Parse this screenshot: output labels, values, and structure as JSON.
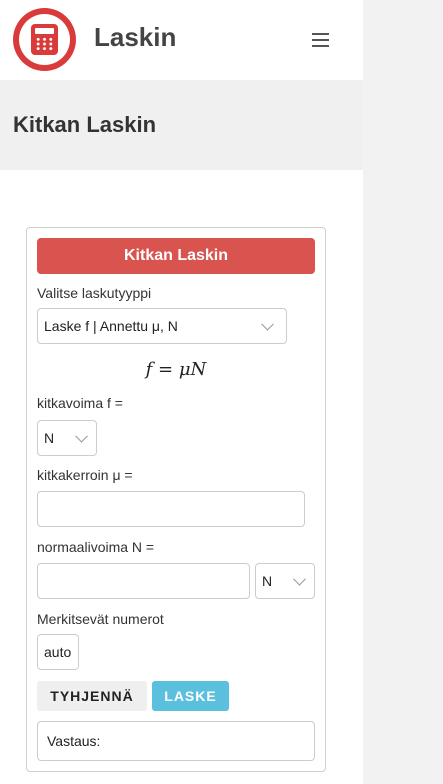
{
  "app": {
    "title": "Laskin",
    "logo_icon": "calculator-icon",
    "brand_color": "#d93b3b"
  },
  "header": {
    "menu_icon": "hamburger-menu-icon"
  },
  "page": {
    "title": "Kitkan Laskin"
  },
  "calculator": {
    "heading": "Kitkan Laskin",
    "heading_color": "#d9534f",
    "calc_type_label": "Valitse laskutyyppi",
    "calc_type_value": "Laske f | Annettu μ, N",
    "formula": "f = μN",
    "friction_force_label": "kitkavoima f =",
    "friction_force_unit": "N",
    "coefficient_label": "kitkakerroin μ =",
    "coefficient_value": "",
    "normal_force_label": "normaalivoima N =",
    "normal_force_value": "",
    "normal_force_unit": "N",
    "sig_figs_label": "Merkitsevät numerot",
    "sig_figs_value": "auto",
    "clear_button": "TYHJENNÄ",
    "calculate_button": "LASKE",
    "calculate_button_color": "#5bc0de",
    "answer_label": "Vastaus:"
  }
}
